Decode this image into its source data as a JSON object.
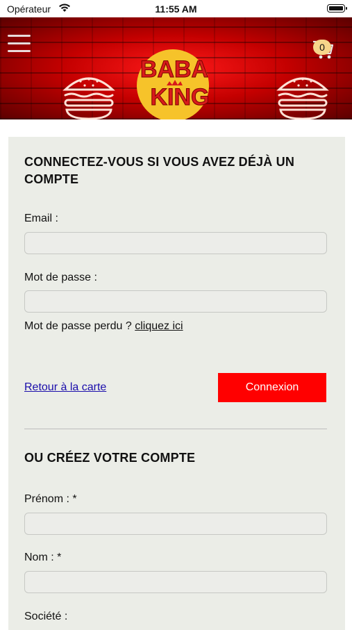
{
  "status_bar": {
    "carrier": "Opérateur",
    "time": "11:55 AM"
  },
  "header": {
    "cart_count": "0",
    "logo_line1": "BABA",
    "logo_line2": "KING"
  },
  "login": {
    "title": "CONNECTEZ-VOUS SI VOUS AVEZ DÉJÀ UN COMPTE",
    "email_label": "Email :",
    "email_value": "",
    "password_label": "Mot de passe :",
    "password_value": "",
    "lost_password_text": "Mot de passe perdu ? ",
    "lost_password_link": "cliquez ici",
    "back_link": "Retour à la carte",
    "submit_label": "Connexion"
  },
  "register": {
    "title": "OU CRÉEZ VOTRE COMPTE",
    "first_name_label": "Prénom : *",
    "last_name_label": "Nom : *",
    "company_label": "Société :"
  },
  "colors": {
    "accent": "#ff0000",
    "card_bg": "#ebede7",
    "link": "#1a0dab",
    "badge": "#f7d58a"
  }
}
